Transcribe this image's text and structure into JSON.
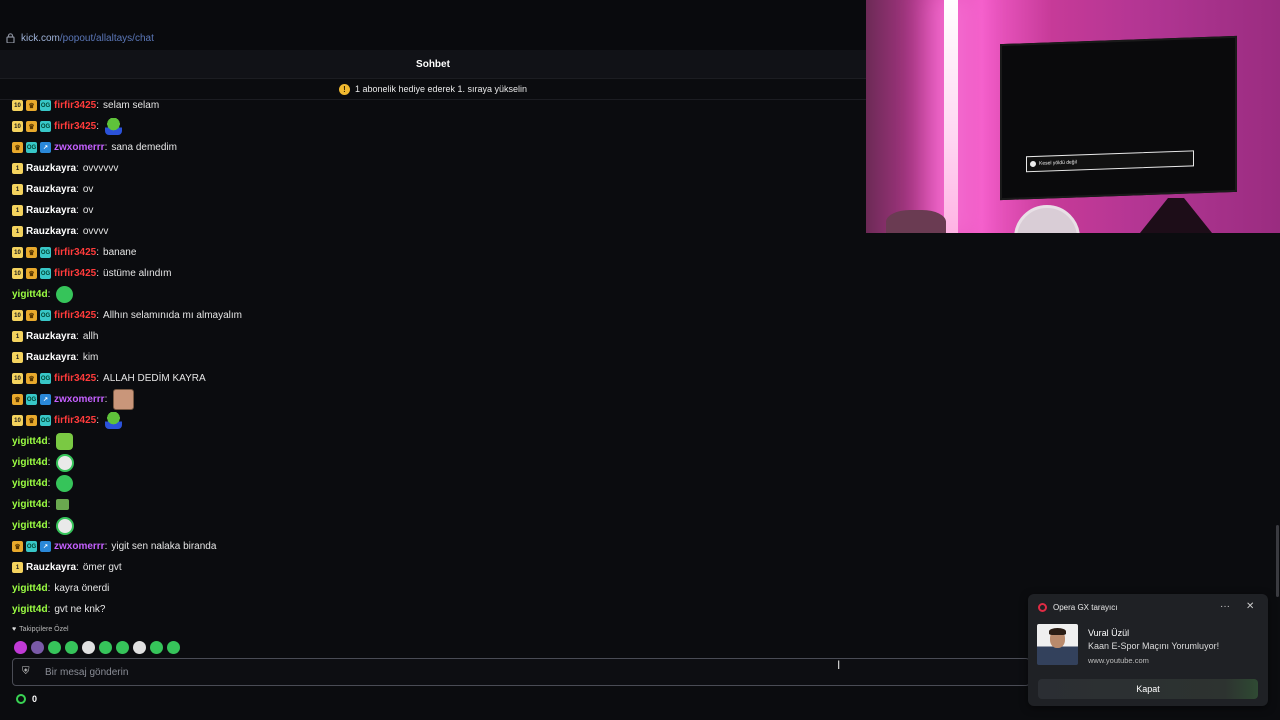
{
  "browser": {
    "url_domain": "kick.com",
    "url_path": "/popout/allaltays/chat"
  },
  "header": {
    "title": "Sohbet"
  },
  "pinned": {
    "icon": "coin-icon",
    "text": "1 abonelik hediye ederek 1. sıraya yükselin"
  },
  "colors": {
    "firfir": "#ff3b3b",
    "zwx": "#c560ff",
    "rauz": "#ffffff",
    "yigit": "#9cff43"
  },
  "messages": [
    {
      "badges": [
        "sub10",
        "crown",
        "og"
      ],
      "user": "firfir3425",
      "color": "#ff3b3b",
      "text": "selam selam",
      "emote": ""
    },
    {
      "badges": [
        "sub10",
        "crown",
        "og"
      ],
      "user": "firfir3425",
      "color": "#ff3b3b",
      "text": "",
      "emote": "pepe"
    },
    {
      "badges": [
        "crown",
        "og",
        "vip"
      ],
      "user": "zwxomerrr",
      "color": "#c560ff",
      "text": "sana demedim",
      "emote": ""
    },
    {
      "badges": [
        "sub"
      ],
      "user": "Rauzkayra",
      "color": "#ffffff",
      "text": "ovvvvvv",
      "emote": ""
    },
    {
      "badges": [
        "sub"
      ],
      "user": "Rauzkayra",
      "color": "#ffffff",
      "text": "ov",
      "emote": ""
    },
    {
      "badges": [
        "sub"
      ],
      "user": "Rauzkayra",
      "color": "#ffffff",
      "text": "ov",
      "emote": ""
    },
    {
      "badges": [
        "sub"
      ],
      "user": "Rauzkayra",
      "color": "#ffffff",
      "text": "ovvvv",
      "emote": ""
    },
    {
      "badges": [
        "sub10",
        "crown",
        "og"
      ],
      "user": "firfir3425",
      "color": "#ff3b3b",
      "text": "banane",
      "emote": ""
    },
    {
      "badges": [
        "sub10",
        "crown",
        "og"
      ],
      "user": "firfir3425",
      "color": "#ff3b3b",
      "text": "üstüme alındım",
      "emote": ""
    },
    {
      "badges": [],
      "user": "yigitt4d",
      "color": "#9cff43",
      "text": "",
      "emote": "green"
    },
    {
      "badges": [
        "sub10",
        "crown",
        "og"
      ],
      "user": "firfir3425",
      "color": "#ff3b3b",
      "text": "Allhın selamınıda mı almayalım",
      "emote": ""
    },
    {
      "badges": [
        "sub"
      ],
      "user": "Rauzkayra",
      "color": "#ffffff",
      "text": "allh",
      "emote": ""
    },
    {
      "badges": [
        "sub"
      ],
      "user": "Rauzkayra",
      "color": "#ffffff",
      "text": "kim",
      "emote": ""
    },
    {
      "badges": [
        "sub10",
        "crown",
        "og"
      ],
      "user": "firfir3425",
      "color": "#ff3b3b",
      "text": "ALLAH DEDİM KAYRA",
      "emote": ""
    },
    {
      "badges": [
        "crown",
        "og",
        "vip"
      ],
      "user": "zwxomerrr",
      "color": "#c560ff",
      "text": "",
      "emote": "face"
    },
    {
      "badges": [
        "sub10",
        "crown",
        "og"
      ],
      "user": "firfir3425",
      "color": "#ff3b3b",
      "text": "",
      "emote": "pepe"
    },
    {
      "badges": [],
      "user": "yigitt4d",
      "color": "#9cff43",
      "text": "",
      "emote": "alien"
    },
    {
      "badges": [],
      "user": "yigitt4d",
      "color": "#9cff43",
      "text": "",
      "emote": "skull"
    },
    {
      "badges": [],
      "user": "yigitt4d",
      "color": "#9cff43",
      "text": "",
      "emote": "green"
    },
    {
      "badges": [],
      "user": "yigitt4d",
      "color": "#9cff43",
      "text": "",
      "emote": "box"
    },
    {
      "badges": [],
      "user": "yigitt4d",
      "color": "#9cff43",
      "text": "",
      "emote": "skull"
    },
    {
      "badges": [
        "crown",
        "og",
        "vip"
      ],
      "user": "zwxomerrr",
      "color": "#c560ff",
      "text": "yigit sen nalaka biranda",
      "emote": ""
    },
    {
      "badges": [
        "sub"
      ],
      "user": "Rauzkayra",
      "color": "#ffffff",
      "text": "ömer gvt",
      "emote": ""
    },
    {
      "badges": [],
      "user": "yigitt4d",
      "color": "#9cff43",
      "text": "kayra önerdi",
      "emote": ""
    },
    {
      "badges": [],
      "user": "yigitt4d",
      "color": "#9cff43",
      "text": "gvt ne knk?",
      "emote": ""
    }
  ],
  "followers_label": "Takipçilere Özel",
  "emote_bar": [
    "#c03ad6",
    "#7a5aa8",
    "#36c45a",
    "#36c45a",
    "#e0e0e0",
    "#36c45a",
    "#36c45a",
    "#e0e0e0",
    "#36c45a",
    "#36c45a"
  ],
  "input": {
    "placeholder": "Bir mesaj gönderin"
  },
  "points": {
    "value": "0"
  },
  "webcam": {
    "tv_dialog_text": "Kesel yöldü değil"
  },
  "notification": {
    "app": "Opera GX tarayıcı",
    "sender": "Vural Üzül",
    "body": "Kaan E-Spor Maçını Yorumluyor!",
    "site": "www.youtube.com",
    "button": "Kapat"
  }
}
